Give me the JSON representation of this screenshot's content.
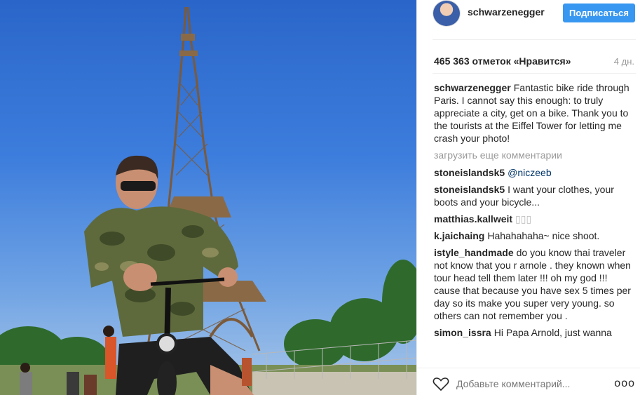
{
  "post": {
    "username": "schwarzenegger",
    "follow_label": "Подписаться",
    "likes": "465 363 отметок «Нравится»",
    "time": "4 дн.",
    "caption": "Fantastic bike ride through Paris. I cannot say this enough: to truly appreciate a city, get on a bike. Thank you to the tourists at the Eiffel Tower for letting me crash your photo!",
    "load_more": "загрузить еще комментарии",
    "comments": [
      {
        "user": "stoneislandsk5",
        "text": "@niczeeb"
      },
      {
        "user": "stoneislandsk5",
        "text": "I want your clothes, your boots and your bicycle..."
      },
      {
        "user": "matthias.kallweit",
        "text": "▯▯▯"
      },
      {
        "user": "k.jaichaing",
        "text": "Hahahahaha~ nice shoot."
      },
      {
        "user": "istyle_handmade",
        "text": "do you know thai traveler not know that you r arnole . they known when tour head tell them later !!! oh my god !!! cause that because you have sex 5 times per day so its make you super very young. so others can not remember you ."
      },
      {
        "user": "simon_issra",
        "text": "Hi Papa Arnold, just wanna"
      }
    ],
    "add_comment_placeholder": "Добавьте комментарий...",
    "more_label": "ooo"
  },
  "icons": {
    "heart": "heart-icon",
    "more": "more-options-icon",
    "avatar": "avatar"
  },
  "colors": {
    "follow_button": "#3897f0",
    "mention": "#003569",
    "muted": "#999999"
  }
}
